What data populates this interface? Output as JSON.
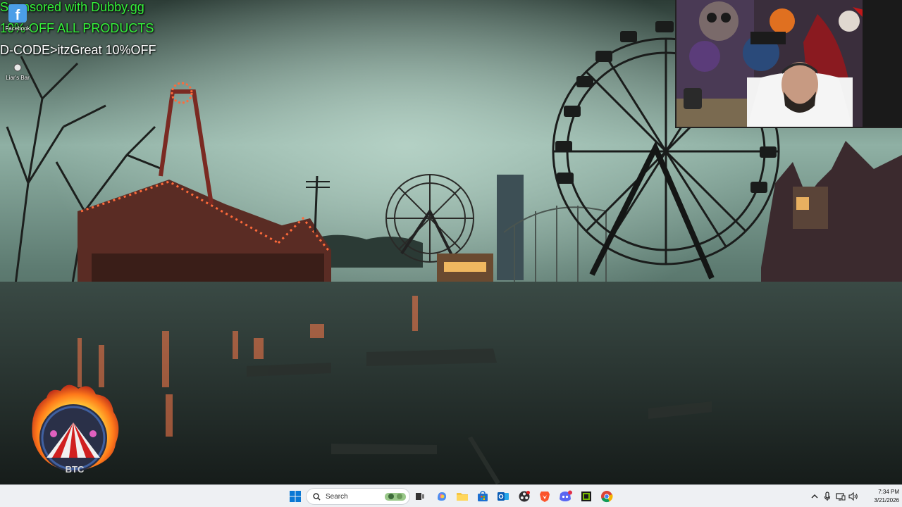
{
  "overlay": {
    "line1": "Sponsored with Dubby.gg",
    "line2": "10% OFF ALL PRODUCTS",
    "line3": "D-CODE>itzGreat 10%OFF"
  },
  "desktop_icons": [
    {
      "label": "Facebook",
      "icon": "facebook-icon"
    },
    {
      "label": "Liar's Bar",
      "icon": "liars-bar-icon"
    }
  ],
  "logo": {
    "text": "BTC"
  },
  "taskbar": {
    "search_placeholder": "Search",
    "apps": [
      "start",
      "search-highlight",
      "task-view",
      "copilot",
      "file-explorer",
      "microsoft-store",
      "outlook",
      "obs",
      "brave",
      "discord",
      "nvidia",
      "chrome"
    ],
    "time": "7:34 PM",
    "date": "3/21/2026"
  },
  "colors": {
    "overlay_green": "#35f23a",
    "overlay_white": "#ffffff",
    "taskbar_bg": "#eef0f3"
  }
}
